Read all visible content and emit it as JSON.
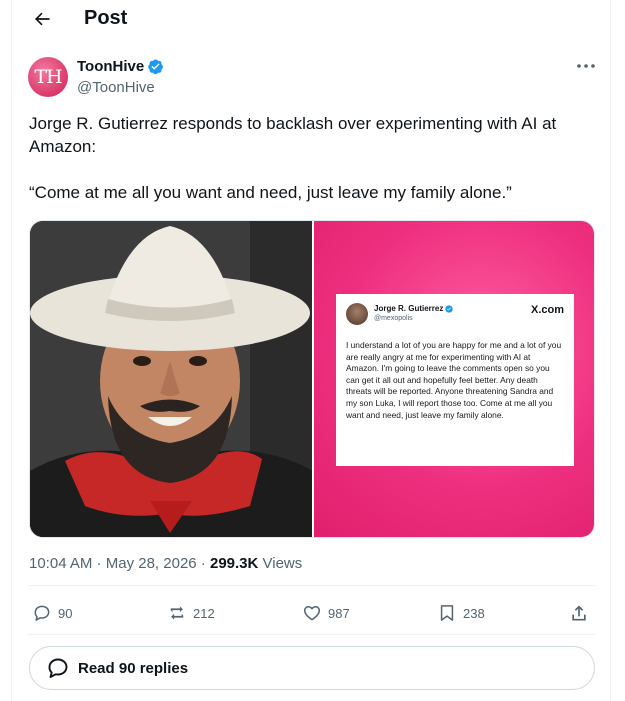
{
  "header": {
    "title": "Post"
  },
  "author": {
    "display_name": "ToonHive",
    "handle": "@ToonHive",
    "avatar_text": "TH"
  },
  "tweet": {
    "line1": "Jorge R. Gutierrez responds to backlash over experimenting with AI at Amazon:",
    "line2": "“Come at me all you want and need, just leave my family alone.”"
  },
  "embed": {
    "name": "Jorge R. Gutierrez",
    "handle": "@mexopolis",
    "site": "X.com",
    "body": "I understand a lot of you are happy for me and a lot of you are really angry at me for experimenting with AI at Amazon. I'm going to leave the comments open so you can get it all out and hopefully feel better. Any death threats will be reported. Anyone threatening Sandra and my son Luka, I will report those too. Come at me all you want and need, just leave my family alone."
  },
  "meta": {
    "time": "10:04 AM",
    "sep1": " · ",
    "date": "May 28, 2026",
    "sep2": " · ",
    "views_count": "299.3K",
    "views_label": " Views"
  },
  "actions": {
    "replies": "90",
    "reposts": "212",
    "likes": "987",
    "bookmarks": "238"
  },
  "read_replies": "Read 90 replies",
  "colors": {
    "accent": "#1d9bf0",
    "muted": "#536471",
    "pink": "#ee2f7f"
  }
}
